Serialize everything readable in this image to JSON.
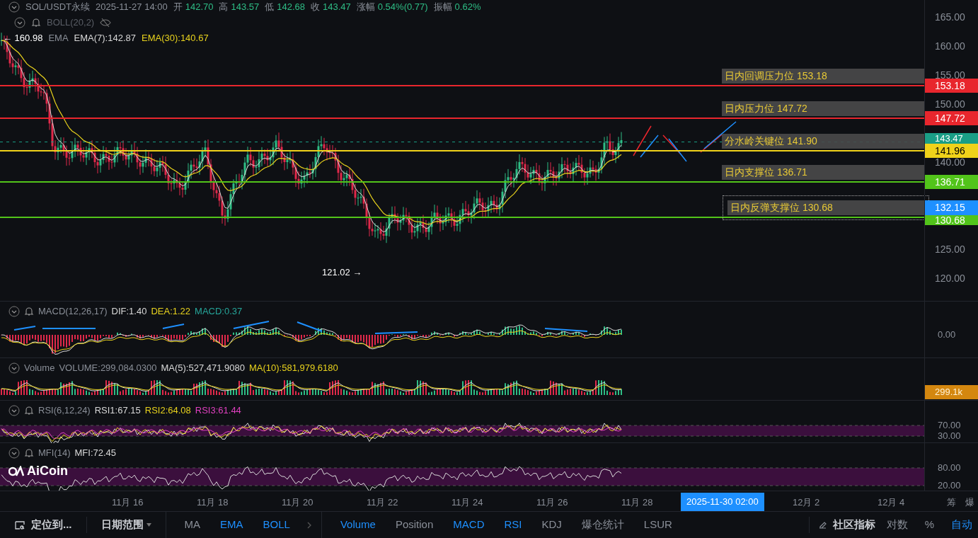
{
  "header": {
    "symbol": "SOL/USDT永续",
    "datetime": "2025-11-27 14:00",
    "quotes": [
      {
        "label": "开",
        "value": "142.70"
      },
      {
        "label": "高",
        "value": "143.57"
      },
      {
        "label": "低",
        "value": "142.68"
      },
      {
        "label": "收",
        "value": "143.47"
      },
      {
        "label": "涨幅",
        "value": "0.54%(0.77)"
      },
      {
        "label": "振幅",
        "value": "0.62%"
      }
    ]
  },
  "overlays": [
    {
      "name": "BOLL(20,2)",
      "visible": false
    },
    {
      "name": "EMA",
      "visible": true,
      "values": [
        {
          "text": "EMA(7):142.87",
          "color": "#d9d9d9"
        },
        {
          "text": "EMA(30):140.67",
          "color": "#e8d21d"
        }
      ]
    }
  ],
  "high_marker": "← 160.98",
  "low_marker": "121.02 →",
  "price_axis": [
    "165.00",
    "160.00",
    "155.00",
    "150.00",
    "140.00",
    "125.00",
    "120.00"
  ],
  "levels": [
    {
      "label": "日内回调压力位 153.18",
      "tag": "153.18",
      "color": "#e8262d",
      "selected": false
    },
    {
      "label": "日内压力位 147.72",
      "tag": "147.72",
      "color": "#e8262d",
      "selected": false
    },
    {
      "label": "分水岭关键位 141.90",
      "tag": "141.96",
      "color": "#f0d21a",
      "selected": false
    },
    {
      "label": "日内支撑位 136.71",
      "tag": "136.71",
      "color": "#52c41a",
      "selected": false
    },
    {
      "label": "日内反弹支撑位 130.68",
      "tag": "130.68",
      "color": "#52c41a",
      "selected": true
    }
  ],
  "price_tags": [
    {
      "text": "143.47",
      "color": "#1a9e86"
    },
    {
      "text": "132.15",
      "color": "#1e90ff"
    }
  ],
  "panes": [
    {
      "kind": "macd",
      "title": "MACD(12,26,17)",
      "alert": true,
      "values": [
        {
          "text": "DIF:1.40",
          "color": "#d9d9d9"
        },
        {
          "text": "DEA:1.22",
          "color": "#e8d21d"
        },
        {
          "text": "MACD:0.37",
          "color": "#26a69a"
        }
      ],
      "ticks": [
        "0.00"
      ]
    },
    {
      "kind": "volume",
      "title": "Volume",
      "alert": false,
      "values": [
        {
          "text": "VOLUME:299,084.0300",
          "color": "#8a8f98"
        },
        {
          "text": "MA(5):527,471.9080",
          "color": "#d9d9d9"
        },
        {
          "text": "MA(10):581,979.6180",
          "color": "#e8d21d"
        }
      ],
      "tag": "299.1k"
    },
    {
      "kind": "rsi",
      "title": "RSI(6,12,24)",
      "alert": true,
      "values": [
        {
          "text": "RSI1:67.15",
          "color": "#d9d9d9"
        },
        {
          "text": "RSI2:64.08",
          "color": "#e8d21d"
        },
        {
          "text": "RSI3:61.44",
          "color": "#e040c0"
        }
      ],
      "ticks": [
        "70.00",
        "30.00"
      ]
    },
    {
      "kind": "mfi",
      "title": "MFI(14)",
      "alert": true,
      "values": [
        {
          "text": "MFI:72.45",
          "color": "#d9d9d9"
        }
      ],
      "ticks": [
        "80.00",
        "20.00"
      ]
    }
  ],
  "logo": "AiCoin",
  "time_axis": {
    "labels": [
      "11月 16",
      "11月 18",
      "11月 20",
      "11月 22",
      "11月 24",
      "11月 26",
      "11月 28",
      "12月 2",
      "12月 4"
    ],
    "cursor": "2025-11-30 02:00",
    "side": [
      "筹",
      "爆"
    ]
  },
  "toolbar": {
    "locate": "定位到...",
    "date_range": "日期范围",
    "indicators": [
      {
        "label": "MA",
        "selected": false
      },
      {
        "label": "EMA",
        "selected": true
      },
      {
        "label": "BOLL",
        "selected": true
      },
      {
        "label": "Volume",
        "selected": true
      },
      {
        "label": "Position",
        "selected": false
      },
      {
        "label": "MACD",
        "selected": true
      },
      {
        "label": "RSI",
        "selected": true
      },
      {
        "label": "KDJ",
        "selected": false
      },
      {
        "label": "爆仓统计",
        "selected": false
      },
      {
        "label": "LSUR",
        "selected": false
      }
    ],
    "community": "社区指标",
    "options": [
      {
        "label": "对数",
        "selected": false
      },
      {
        "label": "%",
        "selected": false
      },
      {
        "label": "自动",
        "selected": true
      }
    ]
  }
}
